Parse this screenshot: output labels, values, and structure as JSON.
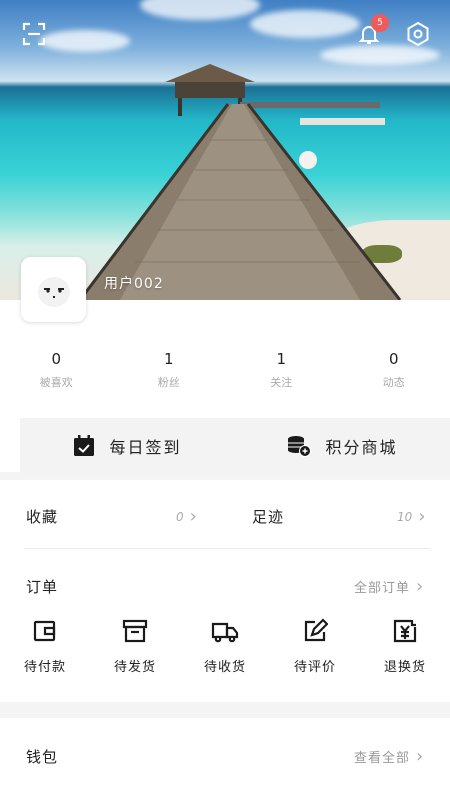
{
  "header": {
    "notification_count": "5"
  },
  "profile": {
    "username": "用户002"
  },
  "stats": [
    {
      "value": "0",
      "label": "被喜欢"
    },
    {
      "value": "1",
      "label": "粉丝"
    },
    {
      "value": "1",
      "label": "关注"
    },
    {
      "value": "0",
      "label": "动态"
    }
  ],
  "actions": {
    "checkin": "每日签到",
    "points_mall": "积分商城"
  },
  "collections": {
    "favorites_label": "收藏",
    "favorites_count": "0",
    "footprints_label": "足迹",
    "footprints_count": "10"
  },
  "orders": {
    "title": "订单",
    "view_all": "全部订单",
    "items": [
      {
        "label": "待付款",
        "icon": "wallet-icon"
      },
      {
        "label": "待发货",
        "icon": "box-icon"
      },
      {
        "label": "待收货",
        "icon": "truck-icon"
      },
      {
        "label": "待评价",
        "icon": "edit-icon"
      },
      {
        "label": "退换货",
        "icon": "refund-icon"
      }
    ]
  },
  "wallet": {
    "title": "钱包",
    "view_all": "查看全部"
  },
  "colors": {
    "badge": "#ef5b5b",
    "muted": "#aaaaaa"
  }
}
